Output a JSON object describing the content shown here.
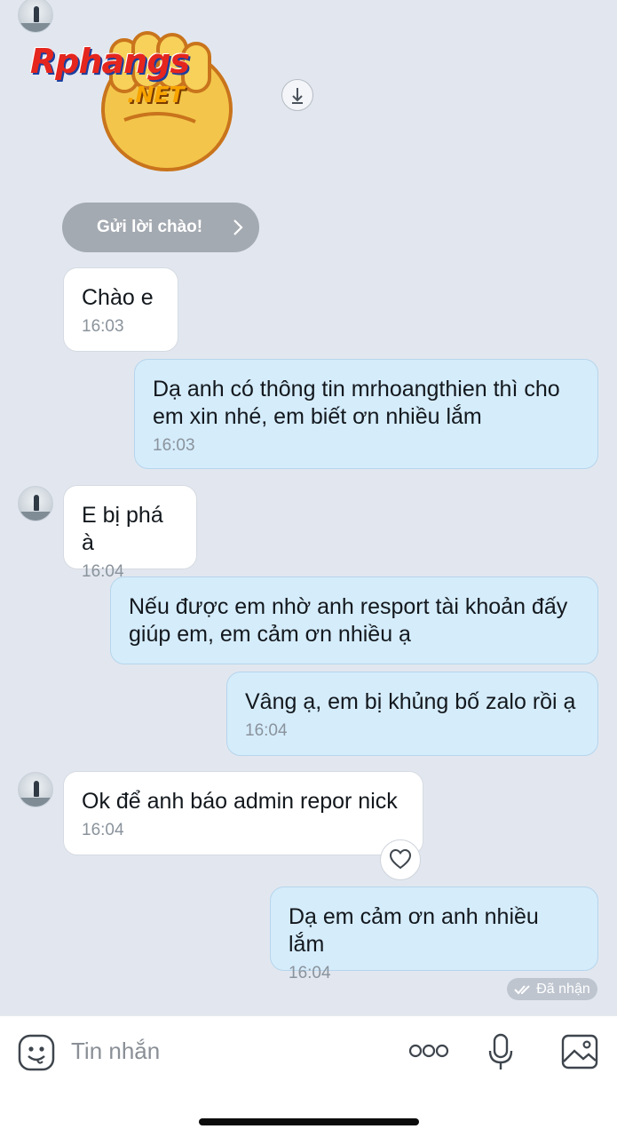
{
  "sticker": {
    "brand_main": "Rphangs",
    "brand_sub": ".NET"
  },
  "greeting_button": {
    "label": "Gửi lời chào!"
  },
  "messages": [
    {
      "side": "in",
      "text": "Chào e",
      "time": "16:03"
    },
    {
      "side": "out",
      "text": "Dạ anh có thông tin mrhoangthien thì cho em xin nhé, em biết ơn nhiều lắm",
      "time": "16:03"
    },
    {
      "side": "in",
      "text": "E bị phá à",
      "time": "16:04"
    },
    {
      "side": "out",
      "text": "Nếu được em nhờ anh resport tài khoản đấy giúp em, em cảm ơn nhiều ạ",
      "time": ""
    },
    {
      "side": "out",
      "text": "Vâng ạ, em bị khủng bố zalo rồi ạ",
      "time": "16:04"
    },
    {
      "side": "in",
      "text": "Ok để anh báo admin repor nick",
      "time": "16:04"
    },
    {
      "side": "out",
      "text": "Dạ em cảm ơn anh nhiều lắm",
      "time": "16:04"
    }
  ],
  "status": {
    "label": "Đã nhận"
  },
  "input": {
    "placeholder": "Tin nhắn"
  },
  "icons": {
    "emoji": "emoji-icon",
    "more": "more-icon",
    "mic": "microphone-icon",
    "image": "image-icon",
    "download": "download-icon",
    "heart": "heart-icon"
  },
  "colors": {
    "background": "#e2e7ef",
    "incoming_bubble": "#ffffff",
    "outgoing_bubble": "#d5ecfb"
  }
}
